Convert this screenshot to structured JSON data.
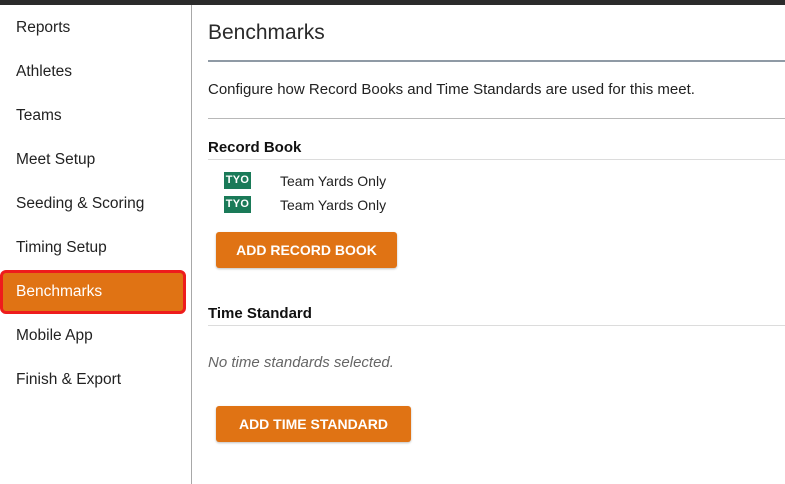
{
  "sidebar": {
    "items": [
      {
        "label": "Reports"
      },
      {
        "label": "Athletes"
      },
      {
        "label": "Teams"
      },
      {
        "label": "Meet Setup"
      },
      {
        "label": "Seeding & Scoring"
      },
      {
        "label": "Timing Setup"
      },
      {
        "label": "Benchmarks",
        "active": true
      },
      {
        "label": "Mobile App"
      },
      {
        "label": "Finish & Export"
      }
    ]
  },
  "main": {
    "title": "Benchmarks",
    "subtitle": "Configure how Record Books and Time Standards are used for this meet.",
    "record_book": {
      "heading": "Record Book",
      "items": [
        {
          "badge": "TYO",
          "name": "Team Yards Only"
        },
        {
          "badge": "TYO",
          "name": "Team Yards Only"
        }
      ],
      "add_button": "ADD RECORD BOOK"
    },
    "time_standard": {
      "heading": "Time Standard",
      "empty_text": "No time standards selected.",
      "add_button": "ADD TIME STANDARD"
    }
  },
  "colors": {
    "accent": "#e07314",
    "highlight_border": "#ee1c1c",
    "badge": "#1a7a58"
  }
}
